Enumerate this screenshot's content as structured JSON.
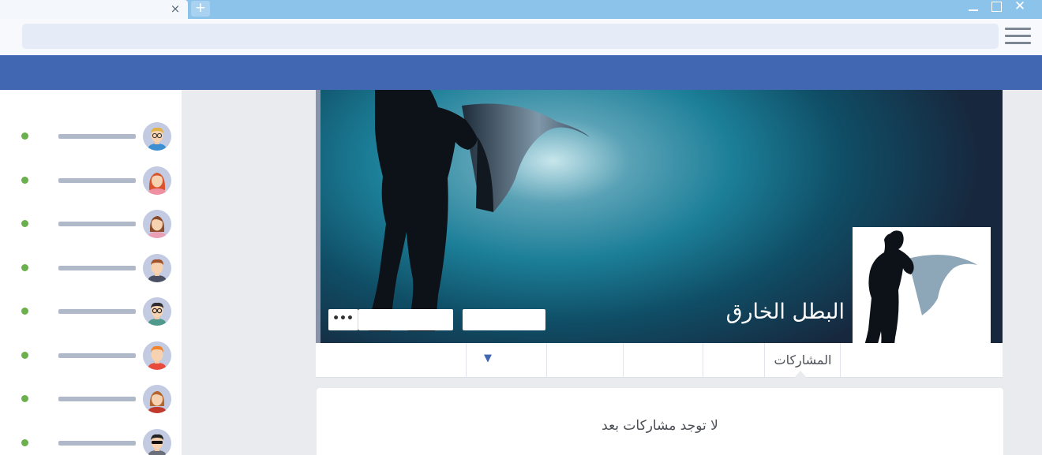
{
  "browser": {
    "tab_close": "×",
    "new_tab": "+",
    "window_close": "✕"
  },
  "colors": {
    "header": "#4267b2",
    "online": "#6ab04c",
    "tab_bar": "#8cc3ea"
  },
  "sidebar": {
    "friends": [
      {
        "icon": "avatar-man-glasses-icon",
        "online": true
      },
      {
        "icon": "avatar-woman-red-hair-icon",
        "online": true
      },
      {
        "icon": "avatar-woman-brown-hair-icon",
        "online": true
      },
      {
        "icon": "avatar-man-brown-hair-icon",
        "online": true
      },
      {
        "icon": "avatar-man-glasses-dark-icon",
        "online": true
      },
      {
        "icon": "avatar-man-orange-hair-icon",
        "online": true
      },
      {
        "icon": "avatar-woman-auburn-hair-icon",
        "online": true
      },
      {
        "icon": "avatar-man-sunglasses-icon",
        "online": true
      }
    ]
  },
  "profile": {
    "name": "البطل الخارق",
    "more_button": "•••",
    "cover_icon": "superhero-silhouette-icon"
  },
  "tabs": {
    "posts": "المشاركات",
    "more": "▼"
  },
  "posts": {
    "empty_message": "لا توجد مشاركات بعد"
  }
}
